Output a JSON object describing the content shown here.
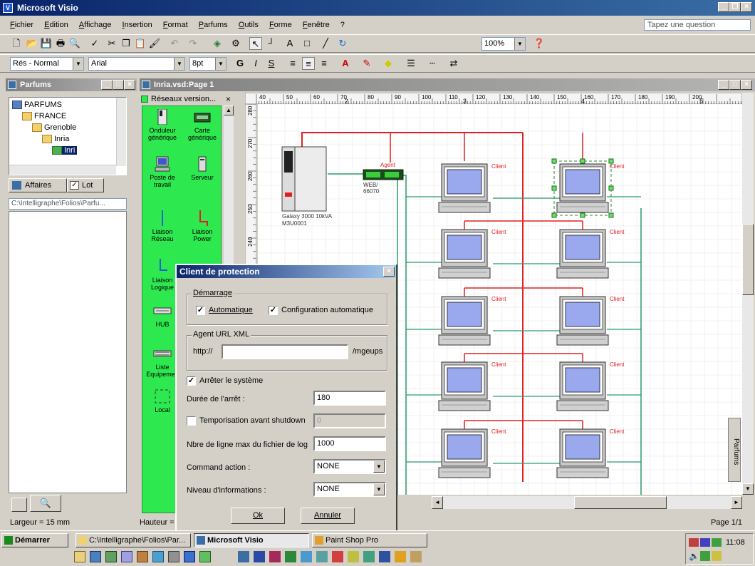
{
  "window": {
    "title": "Microsoft Visio"
  },
  "menu": [
    "Fichier",
    "Edition",
    "Affichage",
    "Insertion",
    "Format",
    "Parfums",
    "Outils",
    "Forme",
    "Fenêtre",
    "?"
  ],
  "ask_placeholder": "Tapez une question",
  "toolbar": {
    "zoom": "100%"
  },
  "format_bar": {
    "style": "Rés - Normal",
    "font": "Arial",
    "size": "8pt",
    "bold": "G",
    "italic": "I",
    "underline": "S"
  },
  "left_panel": {
    "title": "Parfums",
    "tree": [
      "PARFUMS",
      "FRANCE",
      "Grenoble",
      "Inria",
      "Inri"
    ],
    "tabs": [
      "Affaires",
      "Lot"
    ],
    "path": "C:\\Intelligraphe\\Folios\\Parfu..."
  },
  "stencil": {
    "title": "Réseaux version...",
    "shapes": [
      {
        "label": "Onduleur générique"
      },
      {
        "label": "Carte générique"
      },
      {
        "label": "Poste de travail"
      },
      {
        "label": "Serveur"
      },
      {
        "label": "Liaison Réseau"
      },
      {
        "label": "Liaison Power"
      },
      {
        "label": "Liaison Logique"
      },
      {
        "label": "HUB"
      },
      {
        "label": "Liste Equipemen"
      },
      {
        "label": "Local"
      }
    ]
  },
  "document": {
    "title": "Inria.vsd:Page 1",
    "ruler_top": [
      "40",
      "50",
      "60",
      "70",
      "80",
      "90",
      "100",
      "110",
      "120",
      "130",
      "140",
      "150",
      "160",
      "170",
      "180",
      "190",
      "200"
    ],
    "ruler_pages": [
      "2",
      "3",
      "4",
      "5"
    ],
    "ruler_left": [
      "280",
      "270",
      "260",
      "250",
      "240"
    ],
    "ups_label": "Galaxy 3000 10kVA M3U0001",
    "agent_label": "Agent",
    "web_label": "WEB/ 66070",
    "client_label": "Client",
    "side_tab": "Parfums",
    "colors": {
      "power": "#e02020",
      "network": "#2a9a6a",
      "stencil": "#2ee850"
    }
  },
  "dialog": {
    "title": "Client de protection",
    "demarrage": "Démarrage",
    "automatique": "Automatique",
    "config_auto": "Configuration automatique",
    "agent_url": "Agent URL XML",
    "http": "http://",
    "url_value": "",
    "mgeups": "/mgeups",
    "arreter": "Arrêter le système",
    "duree_label": "Durée de l'arrêt :",
    "duree_value": "180",
    "tempo_label": "Temporisation avant shutdown",
    "tempo_value": "0",
    "nbre_label": "Nbre de ligne max du fichier de log",
    "nbre_value": "1000",
    "command_label": "Command action :",
    "command_value": "NONE",
    "niveau_label": "Niveau d'informations :",
    "niveau_value": "NONE",
    "ok": "Ok",
    "annuler": "Annuler"
  },
  "status": {
    "largeur": "Largeur = 15 mm",
    "hauteur": "Hauteur =",
    "page": "Page 1/1"
  },
  "taskbar": {
    "start": "Démarrer",
    "tasks": [
      "C:\\Intelligraphe\\Folios\\Par...",
      "Microsoft Visio",
      "Paint Shop Pro"
    ],
    "clock": "11:08"
  }
}
